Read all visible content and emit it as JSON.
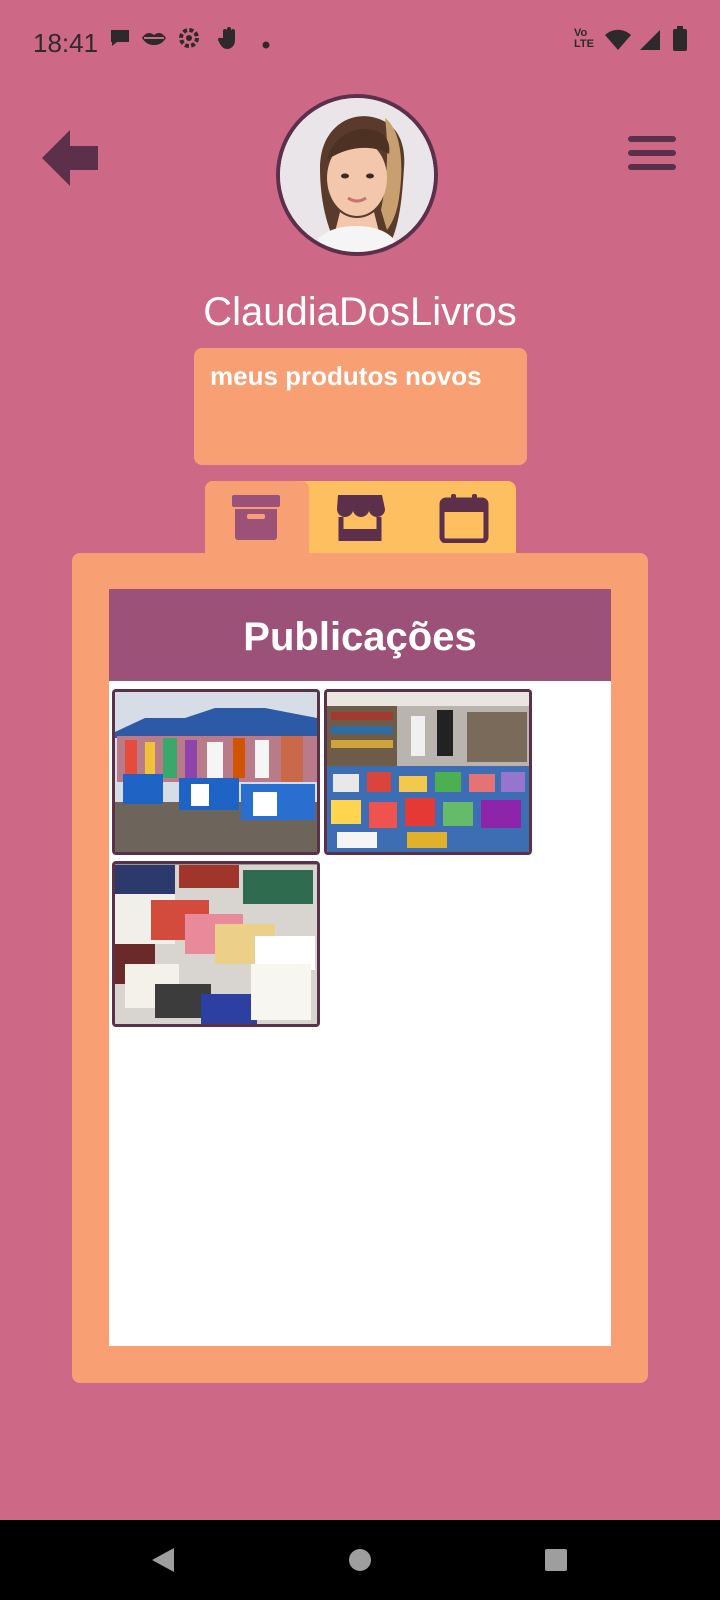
{
  "status_bar": {
    "time": "18:41",
    "left_icons": [
      "chat-bubble-icon",
      "lips-icon",
      "settings-gear-icon",
      "hand-icon",
      "dot-icon"
    ],
    "right_icons": [
      "volte-icon",
      "wifi-icon",
      "signal-icon",
      "battery-icon"
    ],
    "volte_text_top": "Vo",
    "volte_text_bottom": "LTE"
  },
  "header": {
    "back_icon": "arrow-left-icon",
    "menu_icon": "hamburger-menu-icon"
  },
  "profile": {
    "username": "ClaudiaDosLivros",
    "bio": "meus produtos novos"
  },
  "tabs": [
    {
      "icon": "archive-box-icon",
      "active": true
    },
    {
      "icon": "storefront-icon",
      "active": false
    },
    {
      "icon": "calendar-icon",
      "active": false
    }
  ],
  "publications": {
    "title": "Publicações",
    "items": [
      {
        "description": "market-stalls-photo"
      },
      {
        "description": "book-fair-photo"
      },
      {
        "description": "book-stacks-photo"
      }
    ]
  },
  "colors": {
    "background": "#cd6986",
    "accent_dark": "#5c2f4b",
    "bio_box": "#f8a074",
    "tabs": "#fdbf60",
    "header_bar": "#9b5178"
  },
  "nav_bar": {
    "back": "triangle-back-icon",
    "home": "circle-home-icon",
    "recents": "square-recents-icon"
  }
}
